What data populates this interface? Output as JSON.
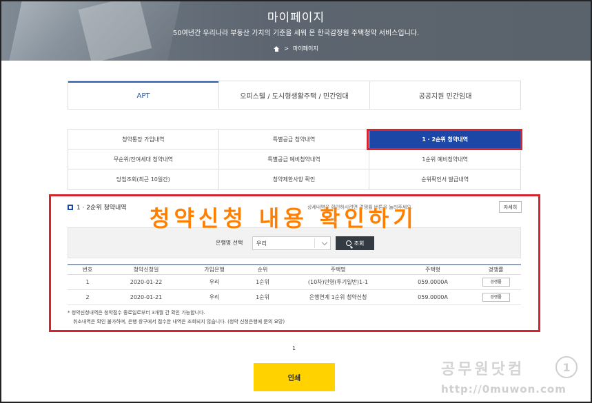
{
  "hero": {
    "title": "마이페이지",
    "subtitle": "50여년간 우리나라 부동산 가치의 기준을 세워 온 한국감정원 주택청약 서비스입니다.",
    "breadcrumb": "마이페이지"
  },
  "tabs": [
    "APT",
    "오피스텔 / 도시형생활주택 / 민간임대",
    "공공지원 민간임대"
  ],
  "menu": [
    "청약통장 가입내역",
    "특별공급 청약내역",
    "1 · 2순위 청약내역",
    "무순위/잔여세대 청약내역",
    "특별공급 예비청약내역",
    "1순위 예비청약내역",
    "당첨조회(최근 10일간)",
    "청약제한사항 확인",
    "순위확인서 발급내역"
  ],
  "section": {
    "title": "1 · 2순위 청약내역",
    "hint": "상세내역을 확인하시려면 경쟁률 버튼을 눌러주세요.",
    "detail_button": "자세히",
    "overlay": "청약신청 내용 확인하기"
  },
  "search": {
    "label": "은행명 선택",
    "selected": "우리",
    "button": "조회"
  },
  "table": {
    "headers": [
      "번호",
      "청약신청일",
      "가입은행",
      "순위",
      "주택명",
      "주택형",
      "경쟁률"
    ],
    "rows": [
      {
        "no": "1",
        "date": "2020-01-22",
        "bank": "우리",
        "rank": "1순위",
        "name": "(10차)민영(투기일반)1-1",
        "type": "059.0000A",
        "btn": "경쟁률"
      },
      {
        "no": "2",
        "date": "2020-01-21",
        "bank": "우리",
        "rank": "1순위",
        "name": "은행연계 1순위 청약신청",
        "type": "059.0000A",
        "btn": "경쟁률"
      }
    ]
  },
  "notes": [
    "* 청약신청내역은 청약접수 종료일로부터 3개월 간 확인 가능합니다.",
    "취소내역은 확인 불가하며, 은행 창구에서 접수한 내역은 조회되지 않습니다. (청약 신청은행에 문의 요망)"
  ],
  "pager": "1",
  "print_button": "인쇄",
  "watermark": {
    "text": "공무원닷컴",
    "url": "http://0muwon.com",
    "logo": "1"
  },
  "colors": {
    "accent": "#1d47a6",
    "highlight": "#d6242f",
    "overlay": "#ff7f00",
    "print": "#ffd200"
  }
}
